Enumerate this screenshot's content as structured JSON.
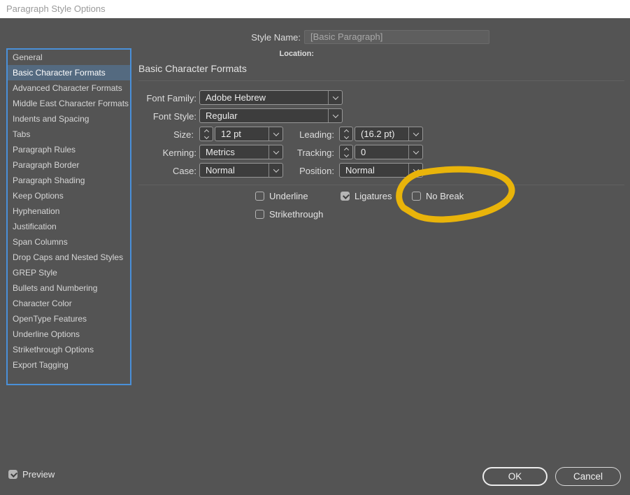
{
  "window": {
    "title": "Paragraph Style Options"
  },
  "sidebar": {
    "items": [
      {
        "label": "General",
        "selected": false
      },
      {
        "label": "Basic Character Formats",
        "selected": true
      },
      {
        "label": "Advanced Character Formats",
        "selected": false
      },
      {
        "label": "Middle East Character Formats",
        "selected": false
      },
      {
        "label": "Indents and Spacing",
        "selected": false
      },
      {
        "label": "Tabs",
        "selected": false
      },
      {
        "label": "Paragraph Rules",
        "selected": false
      },
      {
        "label": "Paragraph Border",
        "selected": false
      },
      {
        "label": "Paragraph Shading",
        "selected": false
      },
      {
        "label": "Keep Options",
        "selected": false
      },
      {
        "label": "Hyphenation",
        "selected": false
      },
      {
        "label": "Justification",
        "selected": false
      },
      {
        "label": "Span Columns",
        "selected": false
      },
      {
        "label": "Drop Caps and Nested Styles",
        "selected": false
      },
      {
        "label": "GREP Style",
        "selected": false
      },
      {
        "label": "Bullets and Numbering",
        "selected": false
      },
      {
        "label": "Character Color",
        "selected": false
      },
      {
        "label": "OpenType Features",
        "selected": false
      },
      {
        "label": "Underline Options",
        "selected": false
      },
      {
        "label": "Strikethrough Options",
        "selected": false
      },
      {
        "label": "Export Tagging",
        "selected": false
      }
    ],
    "accent_border_color": "#4a90d9",
    "selected_bg_color": "#546a80"
  },
  "header": {
    "style_name_label": "Style Name:",
    "style_name_value": "[Basic Paragraph]",
    "location_label": "Location:"
  },
  "section": {
    "title": "Basic Character Formats"
  },
  "form": {
    "font_family": {
      "label": "Font Family:",
      "value": "Adobe Hebrew"
    },
    "font_style": {
      "label": "Font Style:",
      "value": "Regular"
    },
    "size": {
      "label": "Size:",
      "value": "12 pt"
    },
    "leading": {
      "label": "Leading:",
      "value": "(16.2 pt)"
    },
    "kerning": {
      "label": "Kerning:",
      "value": "Metrics"
    },
    "tracking": {
      "label": "Tracking:",
      "value": "0"
    },
    "case": {
      "label": "Case:",
      "value": "Normal"
    },
    "position": {
      "label": "Position:",
      "value": "Normal"
    }
  },
  "checkboxes": {
    "underline": {
      "label": "Underline",
      "checked": false
    },
    "ligatures": {
      "label": "Ligatures",
      "checked": true
    },
    "no_break": {
      "label": "No Break",
      "checked": false
    },
    "strikethrough": {
      "label": "Strikethrough",
      "checked": false
    }
  },
  "annotation": {
    "type": "hand-drawn-ellipse",
    "around": "No Break",
    "color": "#e9b40a"
  },
  "footer": {
    "preview": {
      "label": "Preview",
      "checked": true
    },
    "ok_label": "OK",
    "cancel_label": "Cancel"
  }
}
